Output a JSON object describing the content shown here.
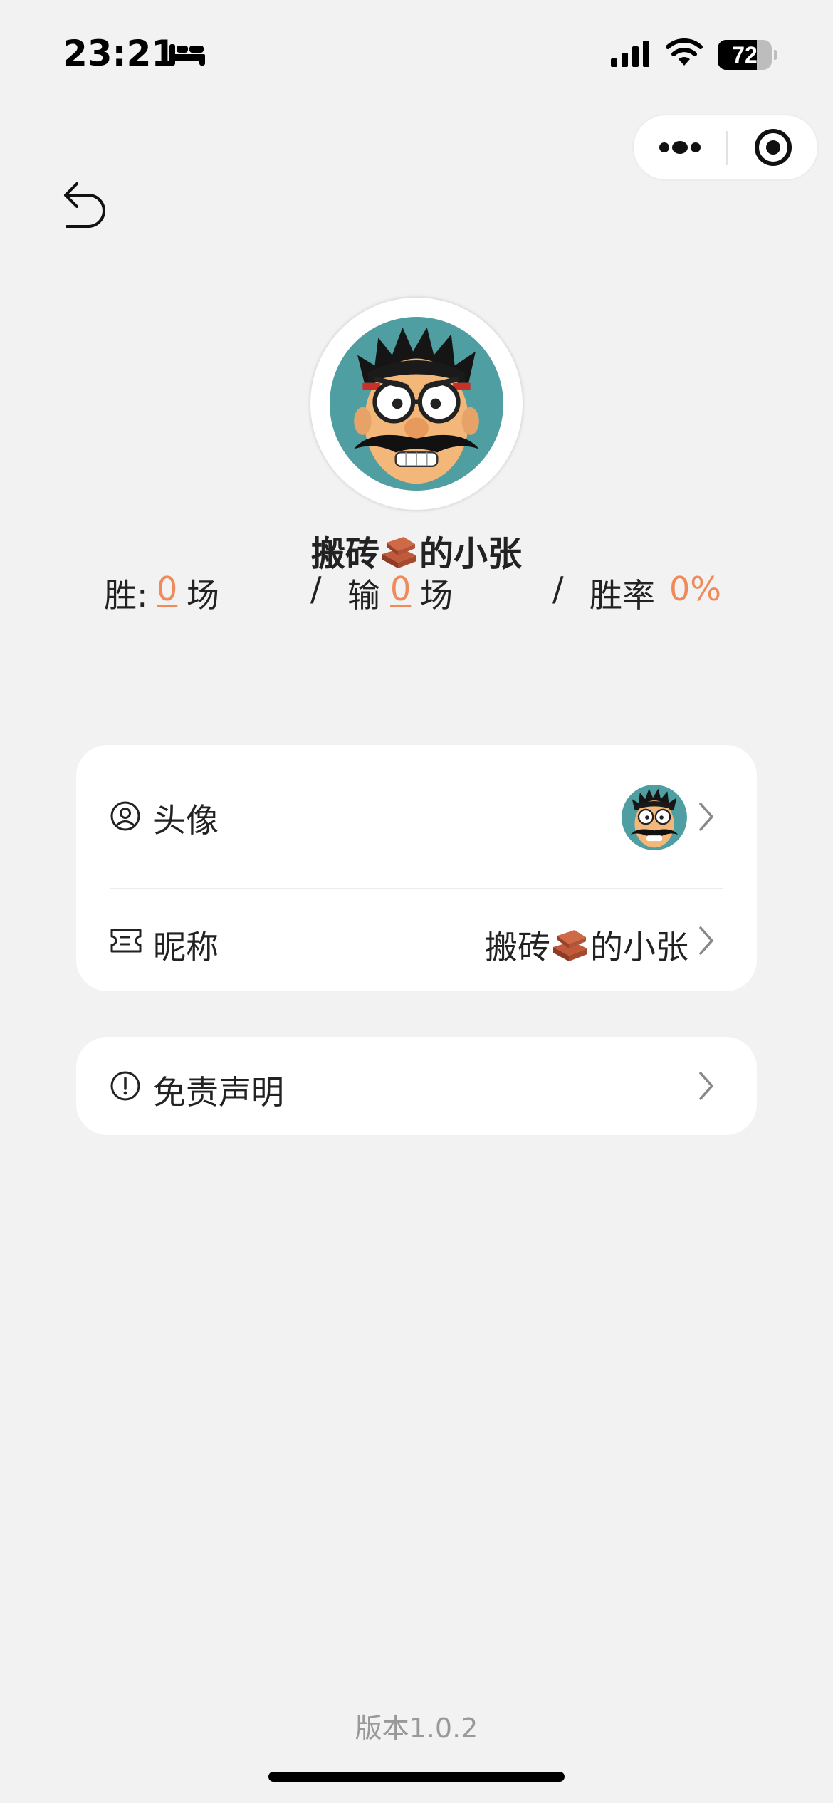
{
  "status_bar": {
    "time": "23:21",
    "battery_level": "72",
    "battery_fraction": 0.72
  },
  "icons": {
    "bed": "bed-icon",
    "signal": "cellular-signal-icon",
    "wifi": "wifi-icon",
    "more": "more-dots-icon",
    "close": "target-close-icon",
    "back": "undo-back-icon",
    "avatar": "user-circle-icon",
    "nickname": "ticket-icon",
    "disclaimer": "exclamation-circle-icon",
    "chevron": "chevron-right-icon"
  },
  "profile": {
    "nickname_prefix": "搬砖",
    "nickname_suffix": "的小张",
    "stats": {
      "win_label": "胜:",
      "win_count": "0",
      "win_unit": "场",
      "sep1": "/",
      "lose_label": "输",
      "lose_count": "0",
      "lose_unit": "场",
      "sep2": "/",
      "rate_label": "胜率",
      "rate_value": "0%"
    }
  },
  "settings": {
    "avatar_label": "头像",
    "nickname_label": "昵称",
    "nickname_value_prefix": "搬砖",
    "nickname_value_suffix": "的小张",
    "disclaimer_label": "免责声明"
  },
  "footer": {
    "version": "版本1.0.2"
  },
  "colors": {
    "accent": "#f08a5a",
    "background": "#f2f2f2",
    "card": "#ffffff",
    "avatar_bg": "#4f9ea2"
  }
}
